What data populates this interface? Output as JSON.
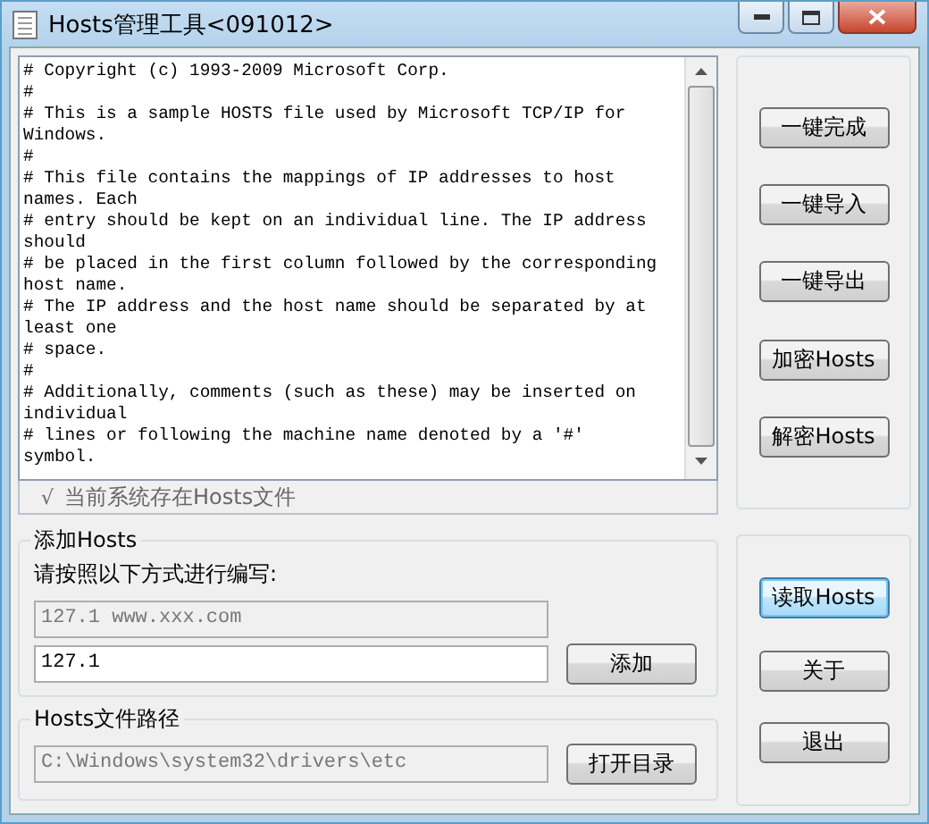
{
  "window": {
    "title": "Hosts管理工具<091012>"
  },
  "hosts_text": {
    "lines": [
      "# Copyright (c) 1993-2009 Microsoft Corp.",
      "#",
      "# This is a sample HOSTS file used by Microsoft TCP/IP for",
      "Windows.",
      "#",
      "# This file contains the mappings of IP addresses to host",
      "names. Each",
      "# entry should be kept on an individual line. The IP address",
      "should",
      "# be placed in the first column followed by the corresponding",
      "host name.",
      "# The IP address and the host name should be separated by at",
      "least one",
      "# space.",
      "#",
      "# Additionally, comments (such as these) may be inserted on",
      "individual",
      "# lines or following the machine name denoted by a '#'",
      "symbol."
    ]
  },
  "status": {
    "icon": "√",
    "text": "当前系统存在Hosts文件"
  },
  "add_group": {
    "title": "添加Hosts",
    "instruction": "请按照以下方式进行编写:",
    "example": "127.1 www.xxx.com",
    "value": "127.1",
    "button": "添加"
  },
  "path_group": {
    "title": "Hosts文件路径",
    "value": "C:\\Windows\\system32\\drivers\\etc",
    "button": "打开目录"
  },
  "top_buttons": [
    {
      "label": "一键完成",
      "focused": false
    },
    {
      "label": "一键导入",
      "focused": false
    },
    {
      "label": "一键导出",
      "focused": false
    },
    {
      "label": "加密Hosts",
      "focused": false
    },
    {
      "label": "解密Hosts",
      "focused": false
    }
  ],
  "bottom_buttons": [
    {
      "label": "读取Hosts",
      "focused": true
    },
    {
      "label": "关于",
      "focused": false
    },
    {
      "label": "退出",
      "focused": false
    }
  ]
}
